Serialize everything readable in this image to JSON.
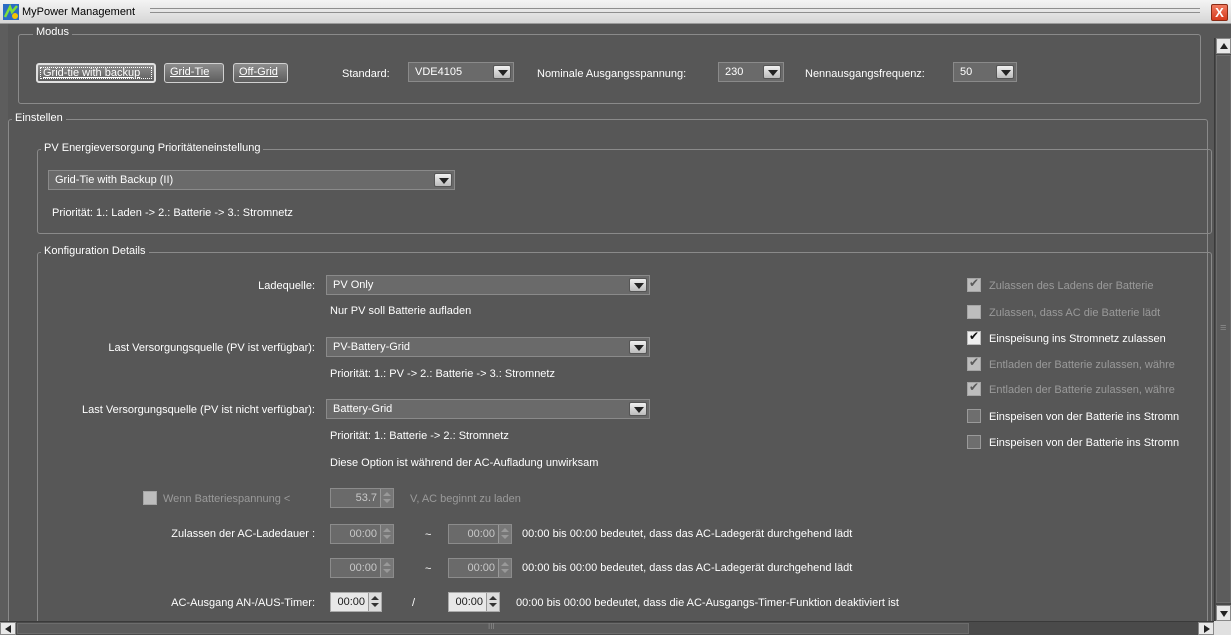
{
  "window": {
    "title": "MyPower Management",
    "close_label": "X"
  },
  "modus": {
    "legend": "Modus",
    "buttons": [
      "Grid-tie with backup",
      "Grid-Tie",
      "Off-Grid"
    ],
    "standard_label": "Standard:",
    "standard_value": "VDE4105",
    "voltage_label": "Nominale Ausgangsspannung:",
    "voltage_value": "230",
    "frequency_label": "Nennausgangsfrequenz:",
    "frequency_value": "50"
  },
  "einstellen": {
    "legend": "Einstellen",
    "pv_priority": {
      "legend": "PV Energieversorgung Prioritäteneinstellung",
      "selected": "Grid-Tie with Backup (II)",
      "description": "Priorität: 1.: Laden -> 2.: Batterie -> 3.: Stromnetz"
    },
    "config": {
      "legend": "Konfiguration Details",
      "ladequelle_label": "Ladequelle:",
      "ladequelle_value": "PV Only",
      "ladequelle_note": "Nur PV soll Batterie aufladen",
      "last_pv_label": "Last Versorgungsquelle (PV ist verfügbar):",
      "last_pv_value": "PV-Battery-Grid",
      "last_pv_note": "Priorität: 1.: PV -> 2.: Batterie -> 3.: Stromnetz",
      "last_nopv_label": "Last Versorgungsquelle (PV ist nicht verfügbar):",
      "last_nopv_value": "Battery-Grid",
      "last_nopv_note1": "Priorität: 1.: Batterie -> 2.: Stromnetz",
      "last_nopv_note2": "Diese Option ist während der AC-Aufladung unwirksam",
      "battery_voltage_label": "Wenn Batteriespannung <",
      "battery_voltage_value": "53.7",
      "battery_voltage_unit": "V,  AC beginnt zu laden",
      "ac_charge_label": "Zulassen der AC-Ladedauer :",
      "ac_charge_rows": [
        {
          "from": "00:00",
          "sep": "~",
          "to": "00:00",
          "note": "00:00 bis 00:00 bedeutet, dass das AC-Ladegerät durchgehend lädt"
        },
        {
          "from": "00:00",
          "sep": "~",
          "to": "00:00",
          "note": "00:00 bis 00:00 bedeutet, dass das AC-Ladegerät durchgehend lädt"
        }
      ],
      "ac_timer_label": "AC-Ausgang AN-/AUS-Timer:",
      "ac_timer_from": "00:00",
      "ac_timer_sep": "/",
      "ac_timer_to": "00:00",
      "ac_timer_note": "00:00 bis 00:00 bedeutet, dass die AC-Ausgangs-Timer-Funktion deaktiviert ist",
      "checkboxes": [
        {
          "label": "Zulassen des Ladens der Batterie",
          "checked": true,
          "enabled": false
        },
        {
          "label": "Zulassen, dass AC die Batterie lädt",
          "checked": false,
          "enabled": false
        },
        {
          "label": "Einspeisung ins Stromnetz zulassen",
          "checked": true,
          "enabled": true
        },
        {
          "label": "Entladen der Batterie zulassen, währe",
          "checked": true,
          "enabled": false
        },
        {
          "label": "Entladen der Batterie zulassen, währe",
          "checked": true,
          "enabled": false
        },
        {
          "label": "Einspeisen von der Batterie ins Stromn",
          "checked": false,
          "enabled": true
        },
        {
          "label": "Einspeisen von der Batterie ins Stromn",
          "checked": false,
          "enabled": true
        }
      ]
    }
  },
  "scrollbar_grip": "III"
}
